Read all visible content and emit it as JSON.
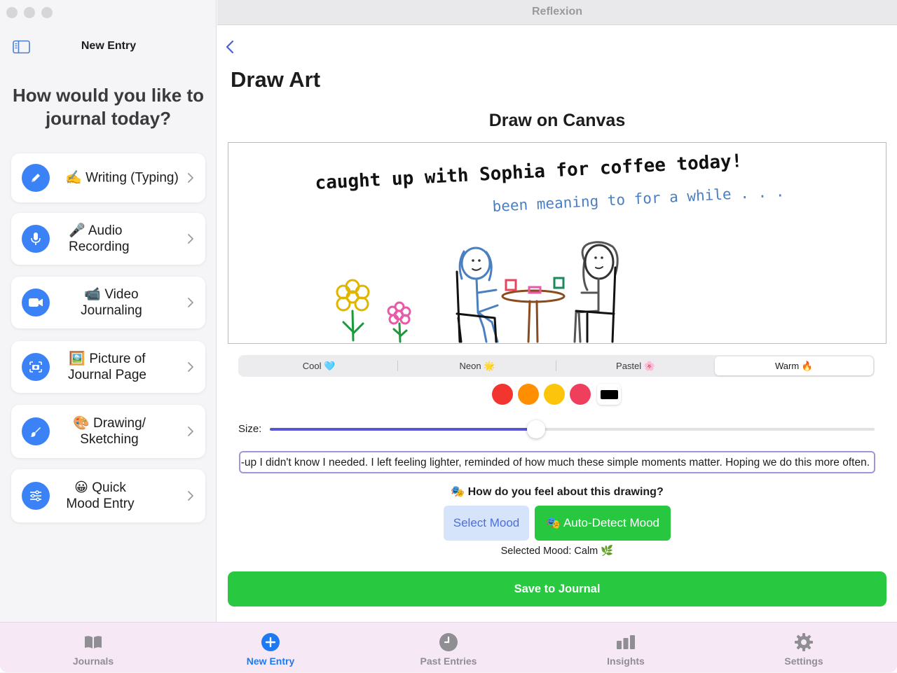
{
  "window": {
    "title": "Reflexion"
  },
  "sidebar": {
    "title": "New Entry",
    "question": "How would you like to journal today?",
    "options": [
      {
        "label": "✍️ Writing (Typing)",
        "icon": "pencil-icon"
      },
      {
        "label": "🎤 Audio Recording",
        "icon": "microphone-icon"
      },
      {
        "label": "📹 Video Journaling",
        "icon": "video-camera-icon"
      },
      {
        "label": "🖼️ Picture of Journal Page",
        "icon": "camera-icon"
      },
      {
        "label": "🎨 Drawing/ Sketching",
        "icon": "paint-brush-icon"
      },
      {
        "label": "😀 Quick Mood Entry",
        "icon": "sliders-icon"
      }
    ]
  },
  "main": {
    "page_title": "Draw Art",
    "canvas_title": "Draw on Canvas",
    "canvas": {
      "line1": "caught up with Sophia for coffee today!",
      "line2": "been meaning to for a while . . ."
    },
    "palettes": [
      "Cool 🩵",
      "Neon 🌟",
      "Pastel 🌸",
      "Warm 🔥"
    ],
    "selected_palette": "Warm 🔥",
    "swatch_colors": [
      "#f2352f",
      "#ff8f00",
      "#fcc40a",
      "#f03e5d",
      "#000000"
    ],
    "size_label": "Size:",
    "size_value": 0.44,
    "note_text": "It was such a warm and easy conversation, the kind of catch-up I didn't know I needed. I left feeling lighter, reminded of how much these simple moments matter. Hoping we do this more often.",
    "feel_prompt": "🎭 How do you feel about this drawing?",
    "select_mood_label": "Select Mood",
    "auto_detect_label": "🎭 Auto-Detect Mood",
    "selected_mood": "Selected Mood: Calm 🌿",
    "save_label": "Save to Journal"
  },
  "tabbar": {
    "tabs": [
      {
        "label": "Journals",
        "icon": "book-icon"
      },
      {
        "label": "New Entry",
        "icon": "plus-circle-icon"
      },
      {
        "label": "Past Entries",
        "icon": "clock-icon"
      },
      {
        "label": "Insights",
        "icon": "bar-chart-icon"
      },
      {
        "label": "Settings",
        "icon": "gear-icon"
      }
    ],
    "active": "New Entry"
  },
  "colors": {
    "accent": "#1d7af3",
    "green": "#28c840",
    "icon_blue": "#3b82f6",
    "ink_blue": "#4a7fc1"
  }
}
